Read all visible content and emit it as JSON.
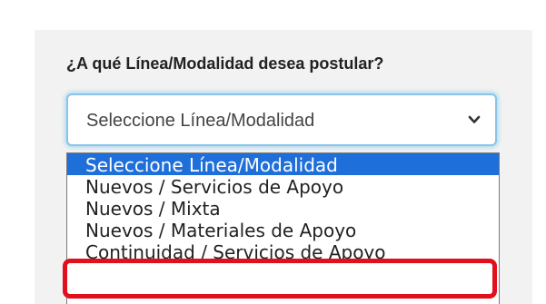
{
  "form": {
    "question": "¿A qué Línea/Modalidad desea postular?",
    "select": {
      "selected_value": "Seleccione Línea/Modalidad",
      "icon": "chevron-down-icon"
    }
  },
  "dropdown": {
    "options": [
      {
        "label": "Seleccione Línea/Modalidad",
        "selected": true
      },
      {
        "label": "Nuevos / Servicios de Apoyo",
        "selected": false
      },
      {
        "label": "Nuevos / Mixta",
        "selected": false
      },
      {
        "label": "Nuevos / Materiales de Apoyo",
        "selected": false
      },
      {
        "label": "Continuidad / Servicios de Apoyo",
        "selected": false,
        "highlighted": true
      }
    ]
  },
  "colors": {
    "panel_background": "#f2f2f2",
    "selected_option": "#1e6fd9",
    "focus_border": "#85c5ea",
    "highlight_annotation": "#e0101c"
  }
}
